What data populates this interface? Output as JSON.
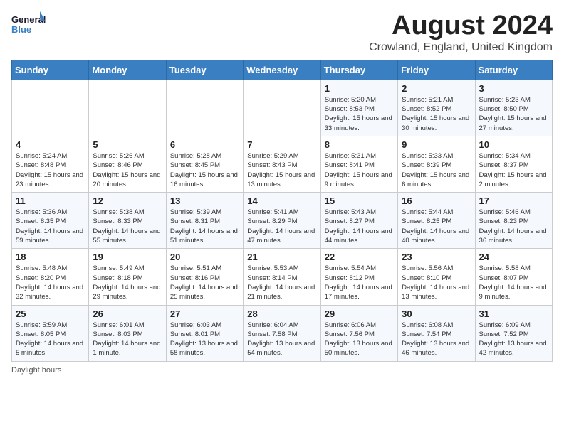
{
  "header": {
    "logo_general": "General",
    "logo_blue": "Blue",
    "month_year": "August 2024",
    "location": "Crowland, England, United Kingdom"
  },
  "days_of_week": [
    "Sunday",
    "Monday",
    "Tuesday",
    "Wednesday",
    "Thursday",
    "Friday",
    "Saturday"
  ],
  "weeks": [
    [
      {
        "day": "",
        "sunrise": "",
        "sunset": "",
        "daylight": ""
      },
      {
        "day": "",
        "sunrise": "",
        "sunset": "",
        "daylight": ""
      },
      {
        "day": "",
        "sunrise": "",
        "sunset": "",
        "daylight": ""
      },
      {
        "day": "",
        "sunrise": "",
        "sunset": "",
        "daylight": ""
      },
      {
        "day": "1",
        "sunrise": "Sunrise: 5:20 AM",
        "sunset": "Sunset: 8:53 PM",
        "daylight": "Daylight: 15 hours and 33 minutes."
      },
      {
        "day": "2",
        "sunrise": "Sunrise: 5:21 AM",
        "sunset": "Sunset: 8:52 PM",
        "daylight": "Daylight: 15 hours and 30 minutes."
      },
      {
        "day": "3",
        "sunrise": "Sunrise: 5:23 AM",
        "sunset": "Sunset: 8:50 PM",
        "daylight": "Daylight: 15 hours and 27 minutes."
      }
    ],
    [
      {
        "day": "4",
        "sunrise": "Sunrise: 5:24 AM",
        "sunset": "Sunset: 8:48 PM",
        "daylight": "Daylight: 15 hours and 23 minutes."
      },
      {
        "day": "5",
        "sunrise": "Sunrise: 5:26 AM",
        "sunset": "Sunset: 8:46 PM",
        "daylight": "Daylight: 15 hours and 20 minutes."
      },
      {
        "day": "6",
        "sunrise": "Sunrise: 5:28 AM",
        "sunset": "Sunset: 8:45 PM",
        "daylight": "Daylight: 15 hours and 16 minutes."
      },
      {
        "day": "7",
        "sunrise": "Sunrise: 5:29 AM",
        "sunset": "Sunset: 8:43 PM",
        "daylight": "Daylight: 15 hours and 13 minutes."
      },
      {
        "day": "8",
        "sunrise": "Sunrise: 5:31 AM",
        "sunset": "Sunset: 8:41 PM",
        "daylight": "Daylight: 15 hours and 9 minutes."
      },
      {
        "day": "9",
        "sunrise": "Sunrise: 5:33 AM",
        "sunset": "Sunset: 8:39 PM",
        "daylight": "Daylight: 15 hours and 6 minutes."
      },
      {
        "day": "10",
        "sunrise": "Sunrise: 5:34 AM",
        "sunset": "Sunset: 8:37 PM",
        "daylight": "Daylight: 15 hours and 2 minutes."
      }
    ],
    [
      {
        "day": "11",
        "sunrise": "Sunrise: 5:36 AM",
        "sunset": "Sunset: 8:35 PM",
        "daylight": "Daylight: 14 hours and 59 minutes."
      },
      {
        "day": "12",
        "sunrise": "Sunrise: 5:38 AM",
        "sunset": "Sunset: 8:33 PM",
        "daylight": "Daylight: 14 hours and 55 minutes."
      },
      {
        "day": "13",
        "sunrise": "Sunrise: 5:39 AM",
        "sunset": "Sunset: 8:31 PM",
        "daylight": "Daylight: 14 hours and 51 minutes."
      },
      {
        "day": "14",
        "sunrise": "Sunrise: 5:41 AM",
        "sunset": "Sunset: 8:29 PM",
        "daylight": "Daylight: 14 hours and 47 minutes."
      },
      {
        "day": "15",
        "sunrise": "Sunrise: 5:43 AM",
        "sunset": "Sunset: 8:27 PM",
        "daylight": "Daylight: 14 hours and 44 minutes."
      },
      {
        "day": "16",
        "sunrise": "Sunrise: 5:44 AM",
        "sunset": "Sunset: 8:25 PM",
        "daylight": "Daylight: 14 hours and 40 minutes."
      },
      {
        "day": "17",
        "sunrise": "Sunrise: 5:46 AM",
        "sunset": "Sunset: 8:23 PM",
        "daylight": "Daylight: 14 hours and 36 minutes."
      }
    ],
    [
      {
        "day": "18",
        "sunrise": "Sunrise: 5:48 AM",
        "sunset": "Sunset: 8:20 PM",
        "daylight": "Daylight: 14 hours and 32 minutes."
      },
      {
        "day": "19",
        "sunrise": "Sunrise: 5:49 AM",
        "sunset": "Sunset: 8:18 PM",
        "daylight": "Daylight: 14 hours and 29 minutes."
      },
      {
        "day": "20",
        "sunrise": "Sunrise: 5:51 AM",
        "sunset": "Sunset: 8:16 PM",
        "daylight": "Daylight: 14 hours and 25 minutes."
      },
      {
        "day": "21",
        "sunrise": "Sunrise: 5:53 AM",
        "sunset": "Sunset: 8:14 PM",
        "daylight": "Daylight: 14 hours and 21 minutes."
      },
      {
        "day": "22",
        "sunrise": "Sunrise: 5:54 AM",
        "sunset": "Sunset: 8:12 PM",
        "daylight": "Daylight: 14 hours and 17 minutes."
      },
      {
        "day": "23",
        "sunrise": "Sunrise: 5:56 AM",
        "sunset": "Sunset: 8:10 PM",
        "daylight": "Daylight: 14 hours and 13 minutes."
      },
      {
        "day": "24",
        "sunrise": "Sunrise: 5:58 AM",
        "sunset": "Sunset: 8:07 PM",
        "daylight": "Daylight: 14 hours and 9 minutes."
      }
    ],
    [
      {
        "day": "25",
        "sunrise": "Sunrise: 5:59 AM",
        "sunset": "Sunset: 8:05 PM",
        "daylight": "Daylight: 14 hours and 5 minutes."
      },
      {
        "day": "26",
        "sunrise": "Sunrise: 6:01 AM",
        "sunset": "Sunset: 8:03 PM",
        "daylight": "Daylight: 14 hours and 1 minute."
      },
      {
        "day": "27",
        "sunrise": "Sunrise: 6:03 AM",
        "sunset": "Sunset: 8:01 PM",
        "daylight": "Daylight: 13 hours and 58 minutes."
      },
      {
        "day": "28",
        "sunrise": "Sunrise: 6:04 AM",
        "sunset": "Sunset: 7:58 PM",
        "daylight": "Daylight: 13 hours and 54 minutes."
      },
      {
        "day": "29",
        "sunrise": "Sunrise: 6:06 AM",
        "sunset": "Sunset: 7:56 PM",
        "daylight": "Daylight: 13 hours and 50 minutes."
      },
      {
        "day": "30",
        "sunrise": "Sunrise: 6:08 AM",
        "sunset": "Sunset: 7:54 PM",
        "daylight": "Daylight: 13 hours and 46 minutes."
      },
      {
        "day": "31",
        "sunrise": "Sunrise: 6:09 AM",
        "sunset": "Sunset: 7:52 PM",
        "daylight": "Daylight: 13 hours and 42 minutes."
      }
    ]
  ],
  "footer": {
    "daylight_label": "Daylight hours"
  }
}
